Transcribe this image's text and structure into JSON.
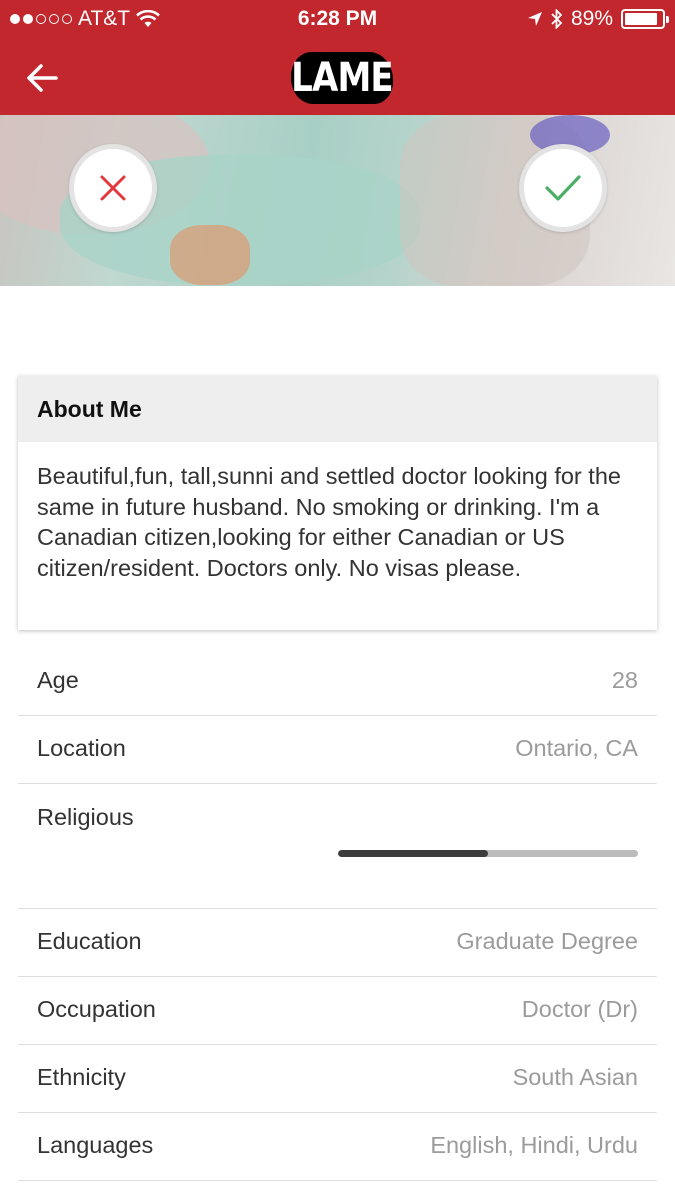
{
  "status_bar": {
    "carrier": "AT&T",
    "time": "6:28 PM",
    "battery": "89%",
    "battery_level": 0.89,
    "signal_bars_filled": 2,
    "signal_bars_total": 5
  },
  "header": {
    "title": "LAME",
    "back_icon": "arrow-left-icon",
    "color": "#c1272d"
  },
  "photo": {
    "page_count": 3,
    "active_page": 1
  },
  "actions": {
    "reject_icon": "close-icon",
    "reject_color": "#e0393e",
    "like_icon": "checkmark-icon",
    "like_color": "#4caf65"
  },
  "about": {
    "heading": "About Me",
    "text": "Beautiful,fun, tall,sunni and settled doctor looking for the same in future husband. No smoking or drinking. I'm a Canadian citizen,looking for either Canadian or US citizen/resident. Doctors only. No visas please."
  },
  "details": {
    "age": {
      "label": "Age",
      "value": "28"
    },
    "location": {
      "label": "Location",
      "value": "Ontario, CA"
    },
    "religious": {
      "label": "Religious",
      "level": 0.5
    },
    "education": {
      "label": "Education",
      "value": "Graduate Degree"
    },
    "occupation": {
      "label": "Occupation",
      "value": "Doctor (Dr)"
    },
    "ethnicity": {
      "label": "Ethnicity",
      "value": "South Asian"
    },
    "languages": {
      "label": "Languages",
      "value": "English, Hindi, Urdu"
    }
  }
}
